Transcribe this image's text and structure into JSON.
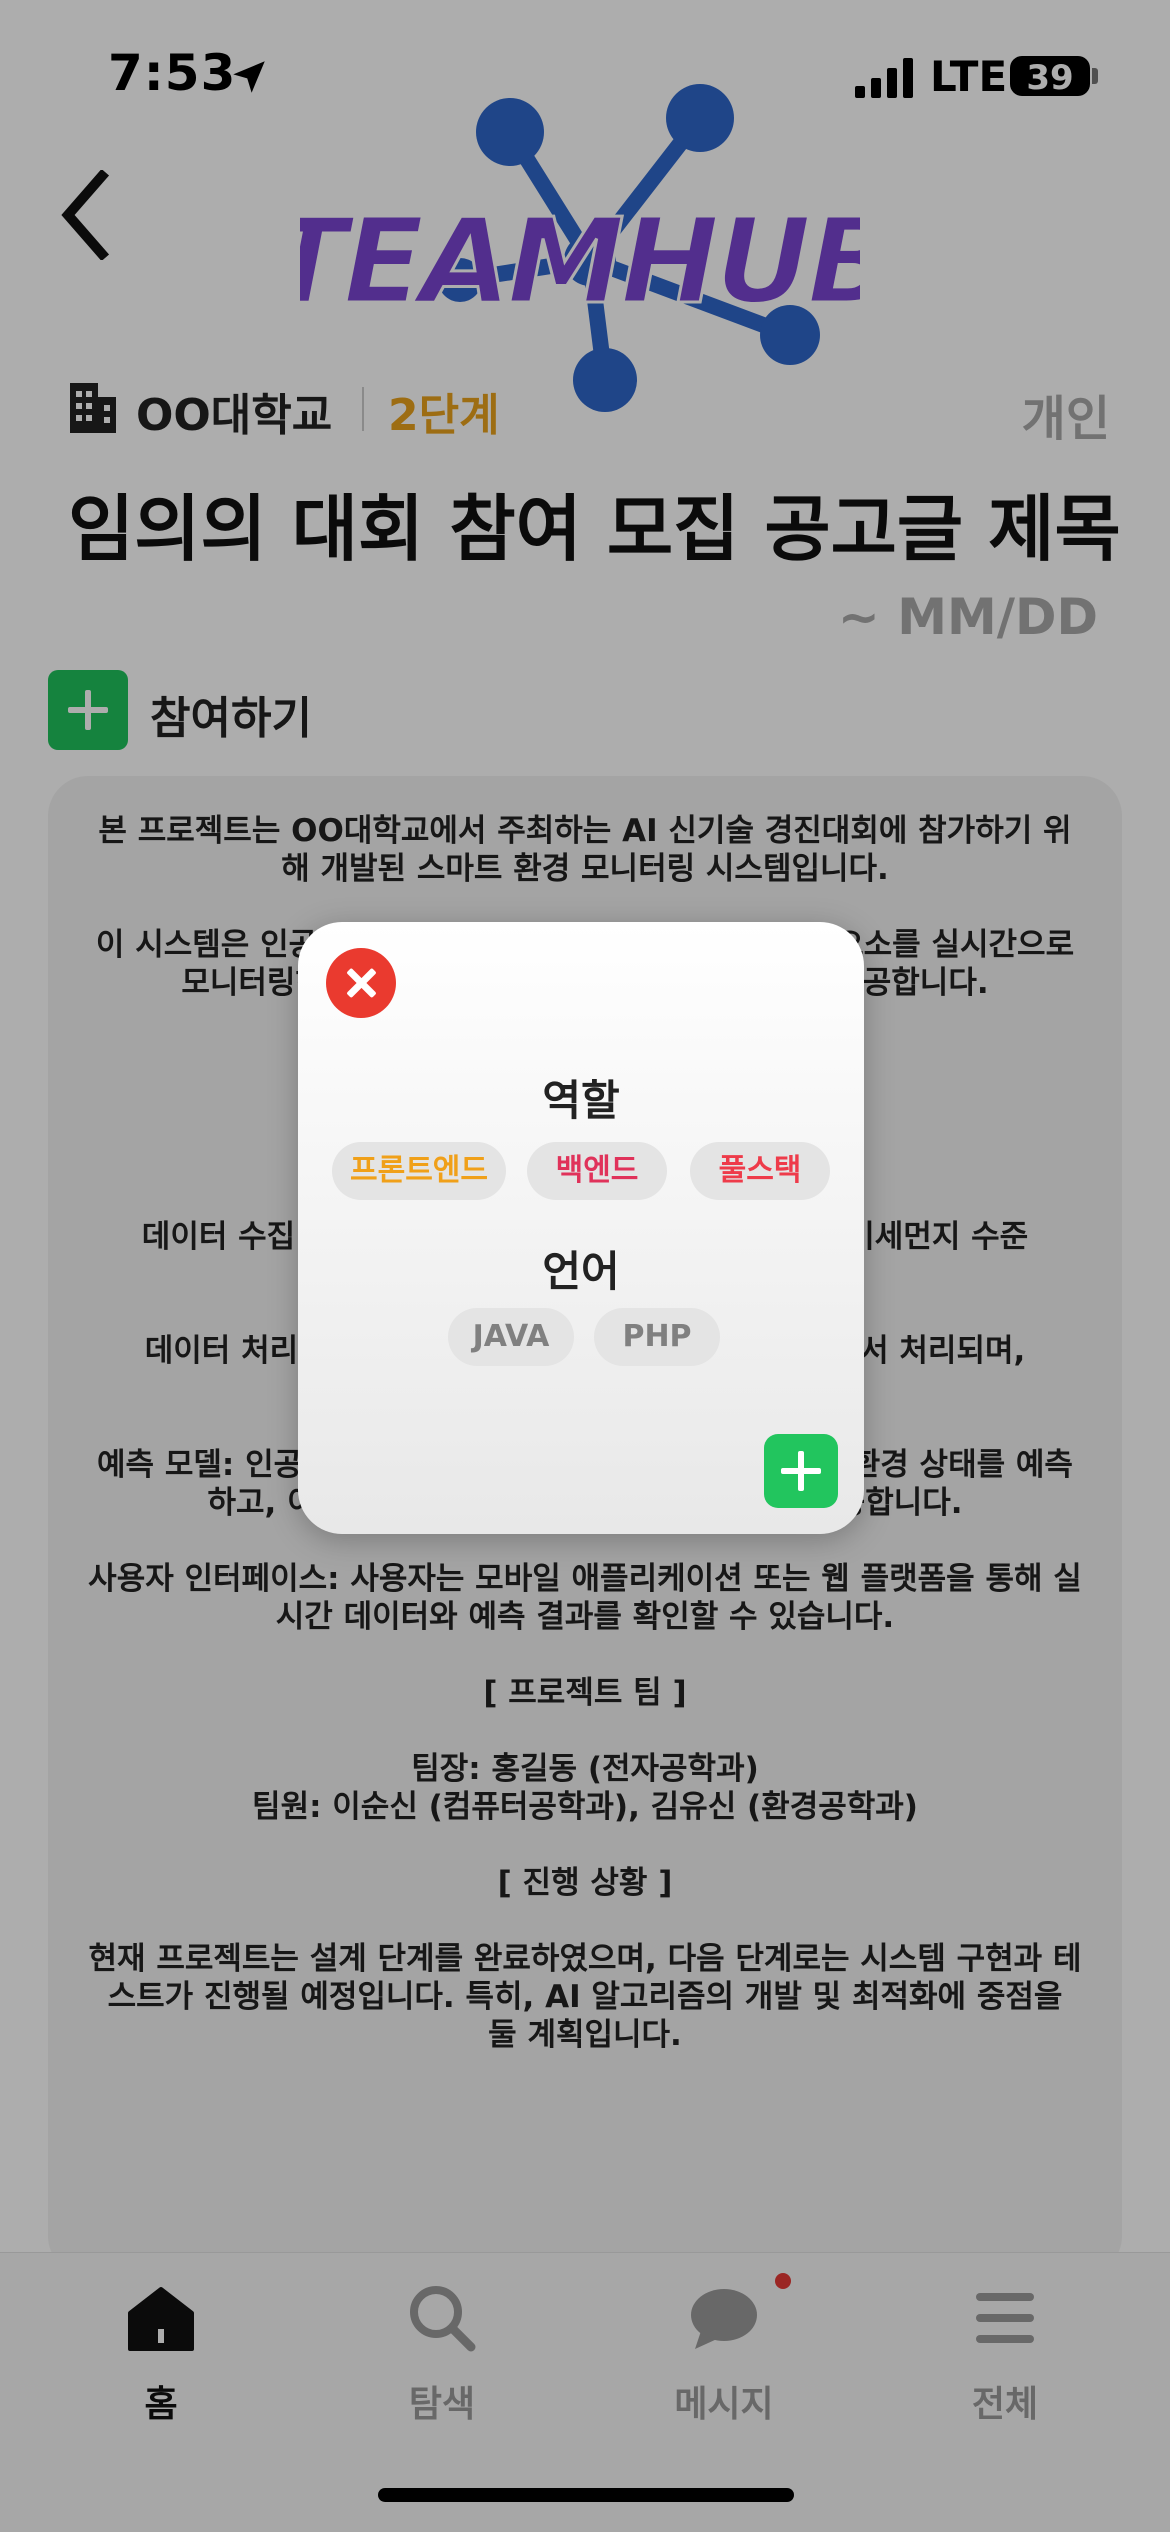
{
  "status_bar": {
    "time": "7:53",
    "network": "LTE",
    "battery": "39"
  },
  "header": {
    "logo_text": "TEAMHUB",
    "school": "OO대학교",
    "stage": "2단계",
    "type": "개인",
    "title": "임의의 대회 참여 모집 공고글 제목",
    "deadline": "~ MM/DD",
    "join_label": "참여하기"
  },
  "content": {
    "paragraphs": [
      "본 프로젝트는 OO대학교에서 주최하는 AI 신기술 경진대회에 참가하기 위해 개발된 스마트 환경 모니터링 시스템입니다.",
      "이 시스템은 인공지능과 IoT 기술을 활용하여 환경 오염 요소를 실시간으로 모니터링하고 분석하여 사용자에게 유용한 정보를 제공합니다.",
      "",
      "데이터 수집: 다양한 센서를 통해 온도, 습도, 대기질, 미세먼지 수준",
      "데이터 처리 및 분석: 수집된 데이터는 클라우드 서버에서 처리되며,",
      "예측 모델: 인공지능 기반의 예측 모델을 사용하여 미래의 환경 상태를 예측하고, 이를 바탕으로 조언 또는 경고 메시지를 제공합니다.",
      "사용자 인터페이스: 사용자는 모바일 애플리케이션 또는 웹 플랫폼을 통해 실시간 데이터와 예측 결과를 확인할 수 있습니다.",
      "[ 프로젝트 팀 ]",
      "팀장: 홍길동 (전자공학과)\n팀원: 이순신 (컴퓨터공학과), 김유신 (환경공학과)",
      "[ 진행 상황 ]",
      "현재 프로젝트는 설계 단계를 완료하였으며, 다음 단계로는 시스템 구현과 테스트가 진행될 예정입니다. 특히, AI 알고리즘의 개발 및 최적화에 중점을 둘 계획입니다."
    ]
  },
  "modal": {
    "role_title": "역할",
    "roles": [
      "프론트엔드",
      "백엔드",
      "풀스택"
    ],
    "language_title": "언어",
    "languages": [
      "JAVA",
      "PHP"
    ]
  },
  "nav": {
    "home": "홈",
    "search": "탐색",
    "message": "메시지",
    "all": "전체"
  },
  "colors": {
    "stage": "#e8a11c",
    "join_button": "#20c25c",
    "close_button": "#ea3a2f",
    "frontend": "#f0a019",
    "backend": "#e0325a",
    "fullstack": "#ee3b4a",
    "message_badge": "#e53935"
  }
}
